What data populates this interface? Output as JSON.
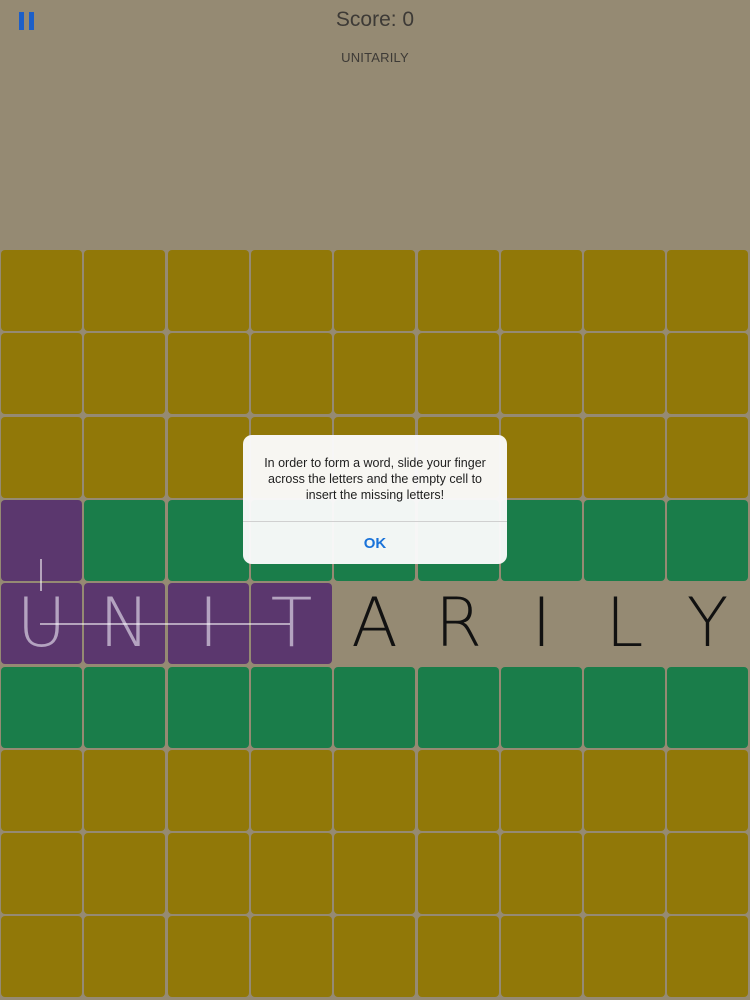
{
  "header": {
    "score_label": "Score: 0",
    "target_word": "UNITARILY"
  },
  "icons": {
    "pause": "pause-icon"
  },
  "colors": {
    "background": "#958a73",
    "yellow_cell": "#917808",
    "green_cell": "#1a7d4a",
    "purple_cell": "#5b376e",
    "pause_icon": "#1c5fc9",
    "ok_text": "#1a73d9"
  },
  "board": {
    "rows": [
      {
        "type": "yellow",
        "cells": [
          "",
          "",
          "",
          "",
          "",
          "",
          "",
          "",
          ""
        ]
      },
      {
        "type": "yellow",
        "cells": [
          "",
          "",
          "",
          "",
          "",
          "",
          "",
          "",
          ""
        ]
      },
      {
        "type": "yellow",
        "cells": [
          "",
          "",
          "",
          "",
          "",
          "",
          "",
          "",
          ""
        ]
      },
      {
        "type": "mixed",
        "cell_types": [
          "purple",
          "green",
          "green",
          "green",
          "green",
          "green",
          "green",
          "green",
          "green"
        ],
        "cells": [
          "",
          "",
          "",
          "",
          "",
          "",
          "",
          "",
          ""
        ]
      },
      {
        "type": "word",
        "cell_types": [
          "purple",
          "purple",
          "purple",
          "purple",
          "empty",
          "empty",
          "empty",
          "empty",
          "empty"
        ],
        "cells": [
          "U",
          "N",
          "I",
          "T",
          "A",
          "R",
          "I",
          "L",
          "Y"
        ]
      },
      {
        "type": "green",
        "cells": [
          "",
          "",
          "",
          "",
          "",
          "",
          "",
          "",
          ""
        ]
      },
      {
        "type": "yellow",
        "cells": [
          "",
          "",
          "",
          "",
          "",
          "",
          "",
          "",
          ""
        ]
      },
      {
        "type": "yellow",
        "cells": [
          "",
          "",
          "",
          "",
          "",
          "",
          "",
          "",
          ""
        ]
      },
      {
        "type": "yellow",
        "cells": [
          "",
          "",
          "",
          "",
          "",
          "",
          "",
          "",
          ""
        ]
      }
    ]
  },
  "dialog": {
    "message": "In order to form a word, slide your finger across the letters and the empty cell to insert the missing letters!",
    "ok_label": "OK"
  }
}
